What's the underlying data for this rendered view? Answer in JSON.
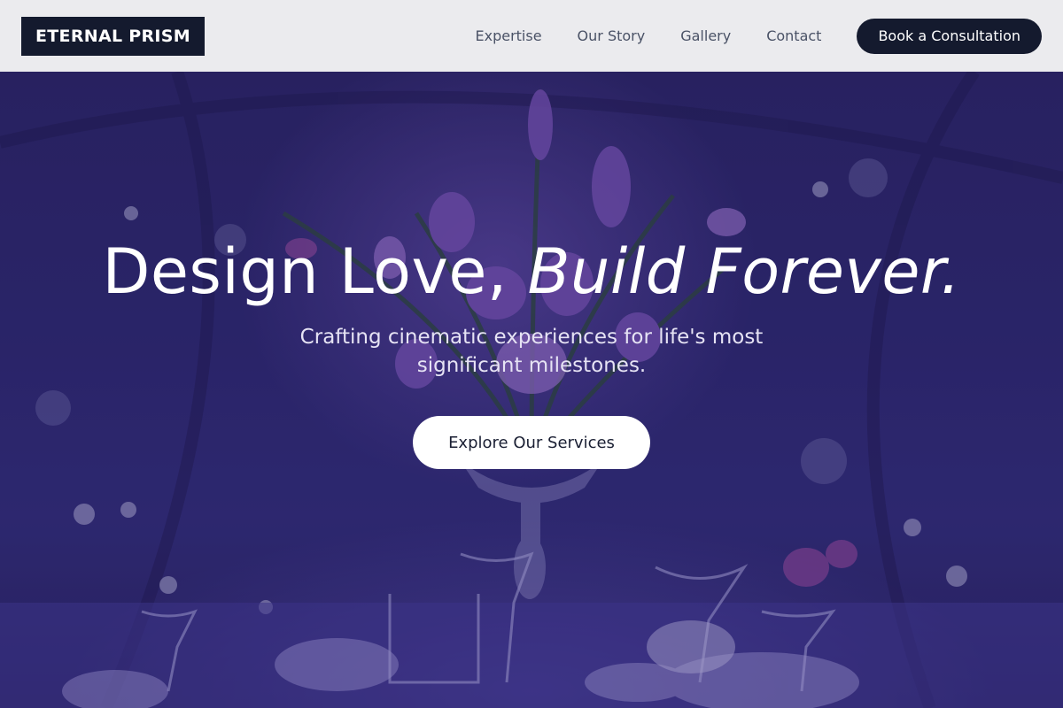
{
  "brand": {
    "logo_text": "ETERNAL PRISM"
  },
  "nav": {
    "items": [
      {
        "label": "Expertise"
      },
      {
        "label": "Our Story"
      },
      {
        "label": "Gallery"
      },
      {
        "label": "Contact"
      }
    ],
    "cta_label": "Book a Consultation"
  },
  "hero": {
    "title_plain": "Design Love, ",
    "title_italic": "Build Forever.",
    "subtitle": "Crafting cinematic experiences for life's most significant milestones.",
    "button_label": "Explore Our Services",
    "background_image": "wedding-table-floral-centerpiece"
  },
  "colors": {
    "header_bg": "#ebebee",
    "brand_dark": "#141a2e",
    "hero_tint": "#2d2870",
    "nav_text": "#4a5266"
  }
}
